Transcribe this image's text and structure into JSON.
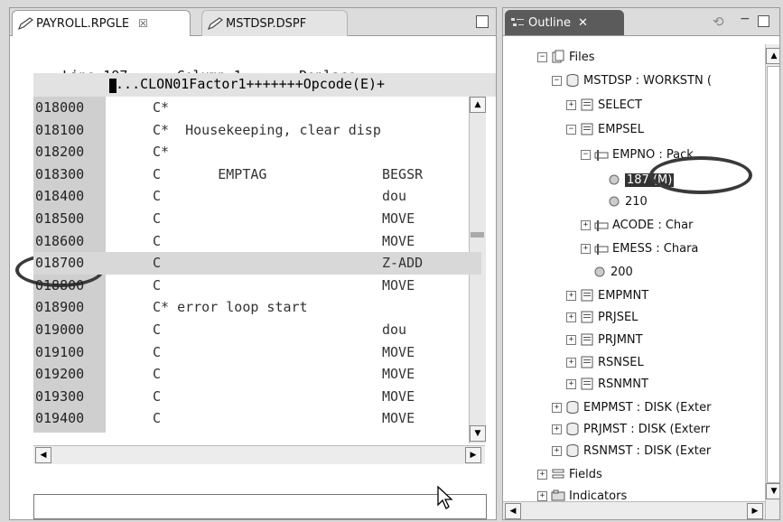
{
  "editor": {
    "tabs": [
      {
        "label": "PAYROLL.RPGLE",
        "close": "☒"
      },
      {
        "label": "MSTDSP.DSPF"
      }
    ],
    "status": {
      "line": "Line 187",
      "column": "Column 1",
      "mode": "Replace"
    },
    "ruler": "....CLON01Factor1+++++++Opcode(E)+",
    "rows": [
      {
        "num": "018000",
        "code": "C*",
        "op": ""
      },
      {
        "num": "018100",
        "code": "C*  Housekeeping, clear disp",
        "op": ""
      },
      {
        "num": "018200",
        "code": "C*",
        "op": ""
      },
      {
        "num": "018300",
        "code": "C       EMPTAG",
        "op": "BEGSR"
      },
      {
        "num": "018400",
        "code": "C",
        "op": "dou"
      },
      {
        "num": "018500",
        "code": "C",
        "op": "MOVE"
      },
      {
        "num": "018600",
        "code": "C",
        "op": "MOVE"
      },
      {
        "num": "018700",
        "code": "C",
        "op": "Z-ADD"
      },
      {
        "num": "018800",
        "code": "C",
        "op": "MOVE"
      },
      {
        "num": "018900",
        "code": "C* error loop start",
        "op": ""
      },
      {
        "num": "019000",
        "code": "C",
        "op": "dou"
      },
      {
        "num": "019100",
        "code": "C",
        "op": "MOVE"
      },
      {
        "num": "019200",
        "code": "C",
        "op": "MOVE"
      },
      {
        "num": "019300",
        "code": "C",
        "op": "MOVE"
      },
      {
        "num": "019400",
        "code": "C",
        "op": "MOVE"
      }
    ],
    "highlighted_row": "018700"
  },
  "outline": {
    "tab_label": "Outline",
    "tree": [
      {
        "label": "Files",
        "exp": "−",
        "icon": "files-icon"
      },
      {
        "label": "MSTDSP : WORKSTN (",
        "exp": "−",
        "icon": "file-db-icon"
      },
      {
        "label": "SELECT",
        "exp": "+",
        "icon": "record-icon"
      },
      {
        "label": "EMPSEL",
        "exp": "−",
        "icon": "record-icon"
      },
      {
        "label": "EMPNO : Pack",
        "exp": "−",
        "icon": "field-icon"
      },
      {
        "label": "187 (M)",
        "exp": "",
        "icon": "reference-icon"
      },
      {
        "label": "210",
        "exp": "",
        "icon": "reference-icon"
      },
      {
        "label": "ACODE : Char",
        "exp": "+",
        "icon": "field-icon"
      },
      {
        "label": "EMESS : Chara",
        "exp": "+",
        "icon": "field-icon"
      },
      {
        "label": "200",
        "exp": "",
        "icon": "reference-icon"
      },
      {
        "label": "EMPMNT",
        "exp": "+",
        "icon": "record-icon"
      },
      {
        "label": "PRJSEL",
        "exp": "+",
        "icon": "record-icon"
      },
      {
        "label": "PRJMNT",
        "exp": "+",
        "icon": "record-icon"
      },
      {
        "label": "RSNSEL",
        "exp": "+",
        "icon": "record-icon"
      },
      {
        "label": "RSNMNT",
        "exp": "+",
        "icon": "record-icon"
      },
      {
        "label": "EMPMST : DISK (Exter",
        "exp": "+",
        "icon": "file-db-icon"
      },
      {
        "label": "PRJMST : DISK (Exterr",
        "exp": "+",
        "icon": "file-db-icon"
      },
      {
        "label": "RSNMST : DISK (Exter",
        "exp": "+",
        "icon": "file-db-icon"
      },
      {
        "label": "Fields",
        "exp": "+",
        "icon": "fields-icon"
      },
      {
        "label": "Indicators",
        "exp": "+",
        "icon": "indicators-icon"
      }
    ]
  }
}
